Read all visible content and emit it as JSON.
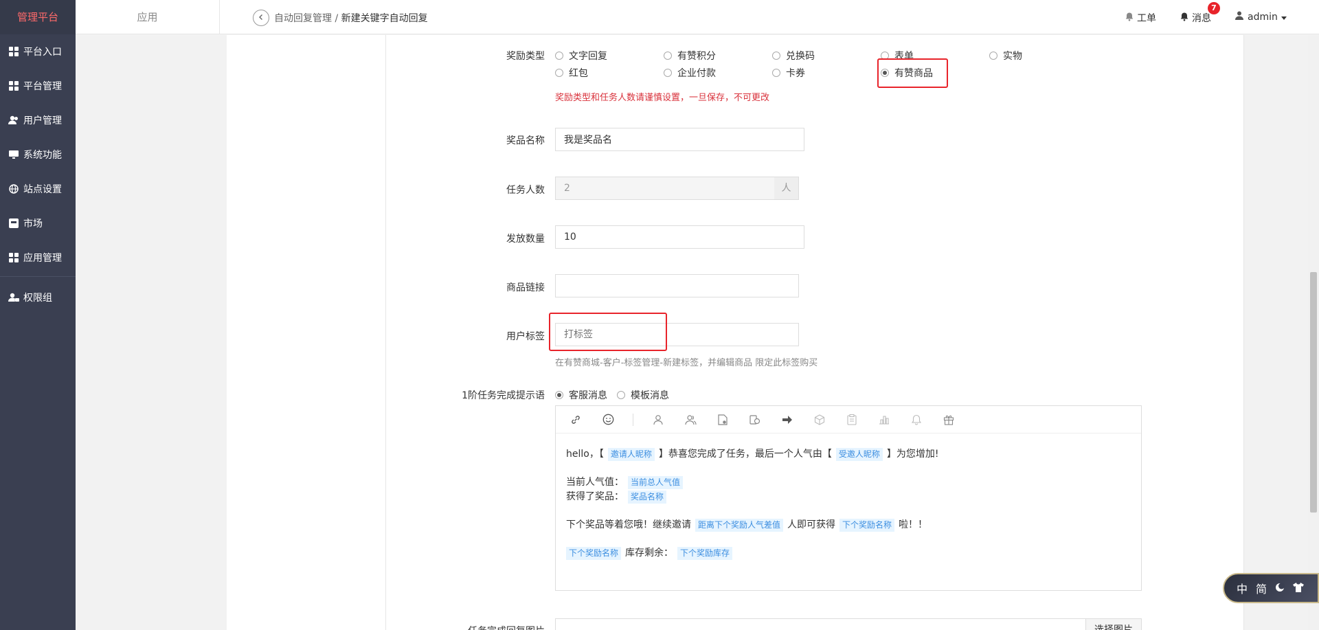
{
  "sidebar": {
    "brand": "管理平台",
    "items": [
      {
        "label": "平台入口",
        "icon": "grid-icon"
      },
      {
        "label": "平台管理",
        "icon": "grid-icon"
      },
      {
        "label": "用户管理",
        "icon": "users-icon"
      },
      {
        "label": "系统功能",
        "icon": "monitor-icon"
      },
      {
        "label": "站点设置",
        "icon": "globe-icon"
      },
      {
        "label": "市场",
        "icon": "store-icon"
      },
      {
        "label": "应用管理",
        "icon": "grid-icon"
      },
      {
        "label": "权限组",
        "icon": "user-lock-icon"
      }
    ]
  },
  "header": {
    "app_tab": "应用",
    "breadcrumb": {
      "parent": "自动回复管理",
      "separator": " / ",
      "current": "新建关键字自动回复"
    },
    "work_order": "工单",
    "messages": "消息",
    "message_count": "7",
    "user": "admin"
  },
  "form": {
    "reward_type": {
      "label": "奖励类型",
      "options": [
        "文字回复",
        "有赞积分",
        "兑换码",
        "表单",
        "实物",
        "红包",
        "企业付款",
        "卡券",
        "有赞商品"
      ],
      "selected": "有赞商品",
      "warning": "奖励类型和任务人数请谨慎设置，一旦保存，不可更改"
    },
    "prize_name": {
      "label": "奖品名称",
      "value": "我是奖品名"
    },
    "task_count": {
      "label": "任务人数",
      "value": "2",
      "unit": "人"
    },
    "issue_count": {
      "label": "发放数量",
      "value": "10"
    },
    "product_link": {
      "label": "商品链接",
      "value": ""
    },
    "user_tag": {
      "label": "用户标签",
      "placeholder": "打标签",
      "hint": "在有赞商城-客户-标签管理-新建标签，并编辑商品 限定此标签购买"
    },
    "level1_prompt": {
      "label": "1阶任务完成提示语",
      "options": [
        "客服消息",
        "模板消息"
      ],
      "selected": "客服消息"
    },
    "editor": {
      "line1_a": "hello，【",
      "tag_inviter": "邀请人昵称",
      "line1_b": "】恭喜您完成了任务，最后一个人气由【",
      "tag_invitee": "受邀人昵称",
      "line1_c": "】为您增加!",
      "line2_a": "当前人气值：",
      "tag_popularity": "当前总人气值",
      "line3_a": "获得了奖品：",
      "tag_prize": "奖品名称",
      "line4_a": "下个奖品等着您哦！继续邀请",
      "tag_gap": "距离下个奖励人气差值",
      "line4_b": "人即可获得",
      "tag_next_name": "下个奖励名称",
      "line4_c": "啦！！",
      "tag_next_name2": "下个奖励名称",
      "line5_a": "库存剩余：",
      "tag_next_stock": "下个奖励库存"
    },
    "bottom": {
      "label": "任务完成回复图片",
      "button": "选择图片"
    }
  },
  "ime": {
    "lang": "中",
    "mode": "简"
  }
}
